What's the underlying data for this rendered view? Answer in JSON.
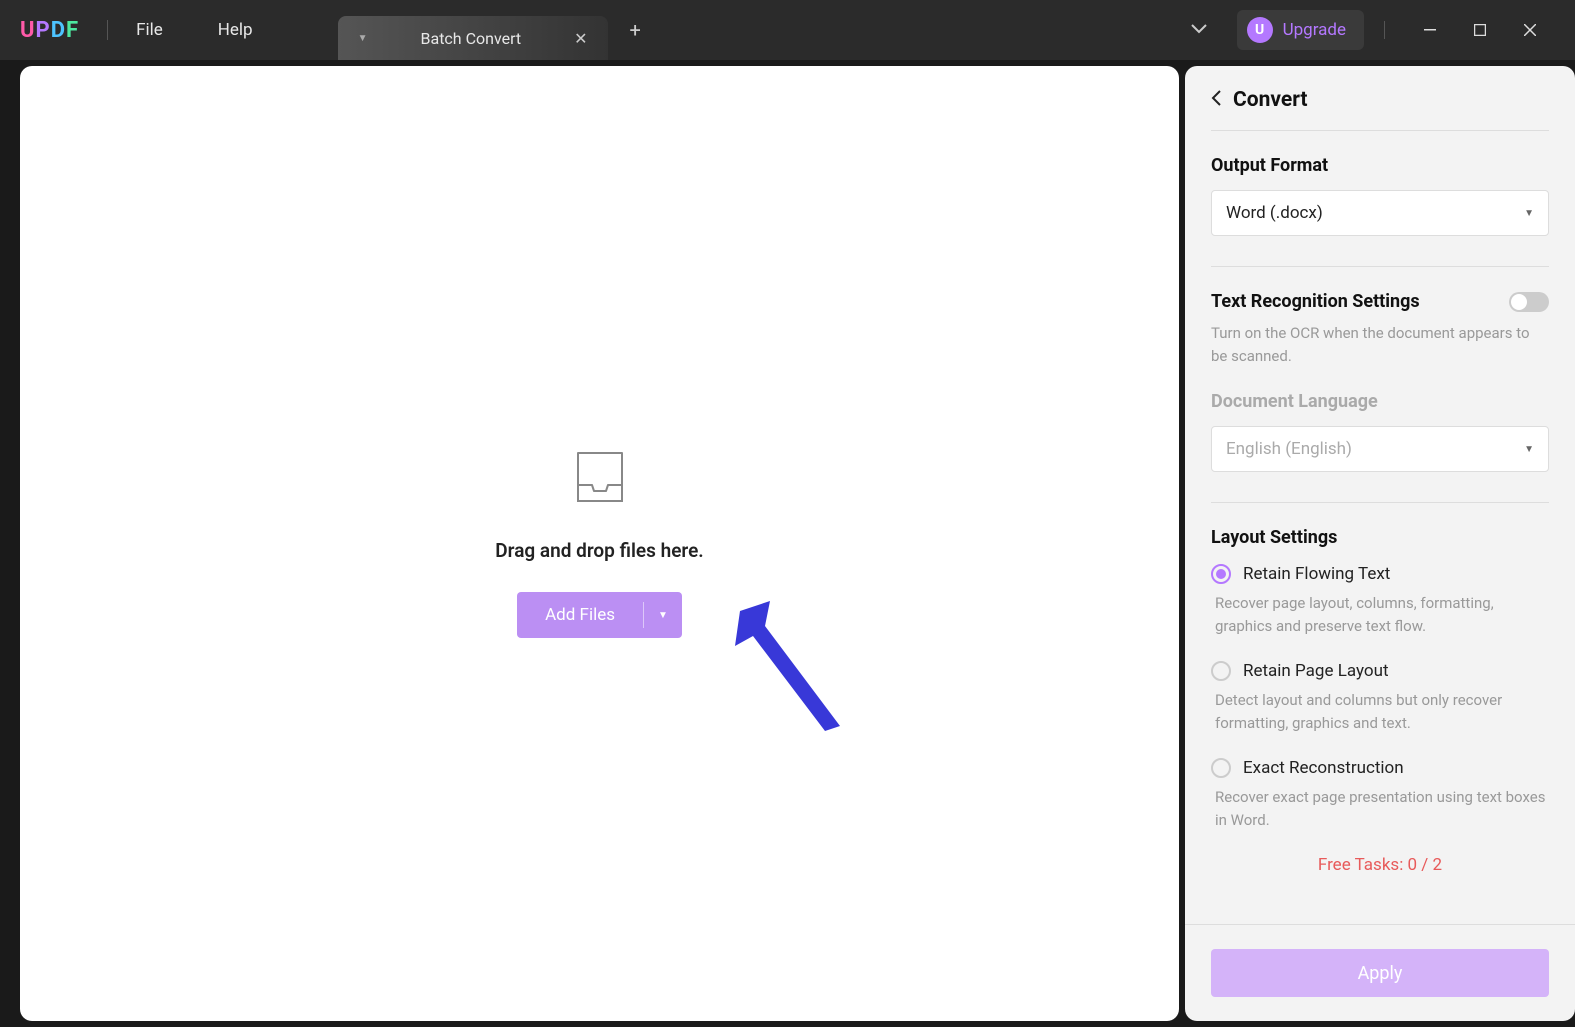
{
  "titlebar": {
    "menu": {
      "file": "File",
      "help": "Help"
    },
    "tab": {
      "label": "Batch Convert"
    },
    "upgrade": {
      "label": "Upgrade",
      "badge": "U"
    }
  },
  "drop": {
    "text": "Drag and drop files here.",
    "button": "Add Files"
  },
  "panel": {
    "title": "Convert",
    "output_format": {
      "label": "Output Format",
      "value": "Word (.docx)"
    },
    "ocr": {
      "label": "Text Recognition Settings",
      "desc": "Turn on the OCR when the document appears to be scanned."
    },
    "lang": {
      "label": "Document Language",
      "value": "English (English)"
    },
    "layout": {
      "label": "Layout Settings",
      "options": [
        {
          "label": "Retain Flowing Text",
          "desc": "Recover page layout, columns, formatting, graphics and preserve text flow."
        },
        {
          "label": "Retain Page Layout",
          "desc": "Detect layout and columns but only recover formatting, graphics and text."
        },
        {
          "label": "Exact Reconstruction",
          "desc": "Recover exact page presentation using text boxes in Word."
        }
      ]
    },
    "free_tasks": "Free Tasks: 0 / 2",
    "apply": "Apply"
  }
}
